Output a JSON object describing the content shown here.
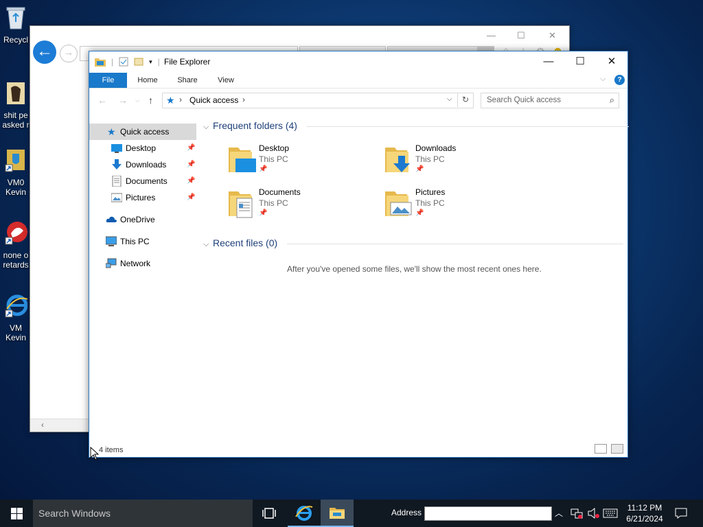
{
  "desktop": {
    "icons": [
      {
        "label": "Recycl"
      },
      {
        "label": "shit pe asked r"
      },
      {
        "label": "VM0 Kevin"
      },
      {
        "label": "none o retards"
      },
      {
        "label": "VM Kevin"
      }
    ]
  },
  "explorer": {
    "title": "File Explorer",
    "ribbon_tabs": [
      "File",
      "Home",
      "Share",
      "View"
    ],
    "address": "Quick access",
    "search_placeholder": "Search Quick access",
    "nav": [
      {
        "label": "Quick access",
        "icon": "star-icon"
      },
      {
        "label": "Desktop",
        "icon": "desktop-icon",
        "pinned": true
      },
      {
        "label": "Downloads",
        "icon": "download-icon",
        "pinned": true
      },
      {
        "label": "Documents",
        "icon": "document-icon",
        "pinned": true
      },
      {
        "label": "Pictures",
        "icon": "pictures-icon",
        "pinned": true
      },
      {
        "label": "OneDrive",
        "icon": "cloud-icon"
      },
      {
        "label": "This PC",
        "icon": "computer-icon"
      },
      {
        "label": "Network",
        "icon": "network-icon"
      }
    ],
    "frequent_header": "Frequent folders (4)",
    "folders": [
      {
        "name": "Desktop",
        "location": "This PC"
      },
      {
        "name": "Downloads",
        "location": "This PC"
      },
      {
        "name": "Documents",
        "location": "This PC"
      },
      {
        "name": "Pictures",
        "location": "This PC"
      }
    ],
    "recent_header": "Recent files (0)",
    "recent_empty": "After you've opened some files, we'll show the most recent ones here.",
    "status": "4 items"
  },
  "taskbar": {
    "search_placeholder": "Search Windows",
    "address_label": "Address",
    "time": "11:12 PM",
    "date": "6/21/2024"
  },
  "colors": {
    "accent": "#1979ca",
    "selection": "#d9d9d9",
    "taskbar": "#101821"
  }
}
